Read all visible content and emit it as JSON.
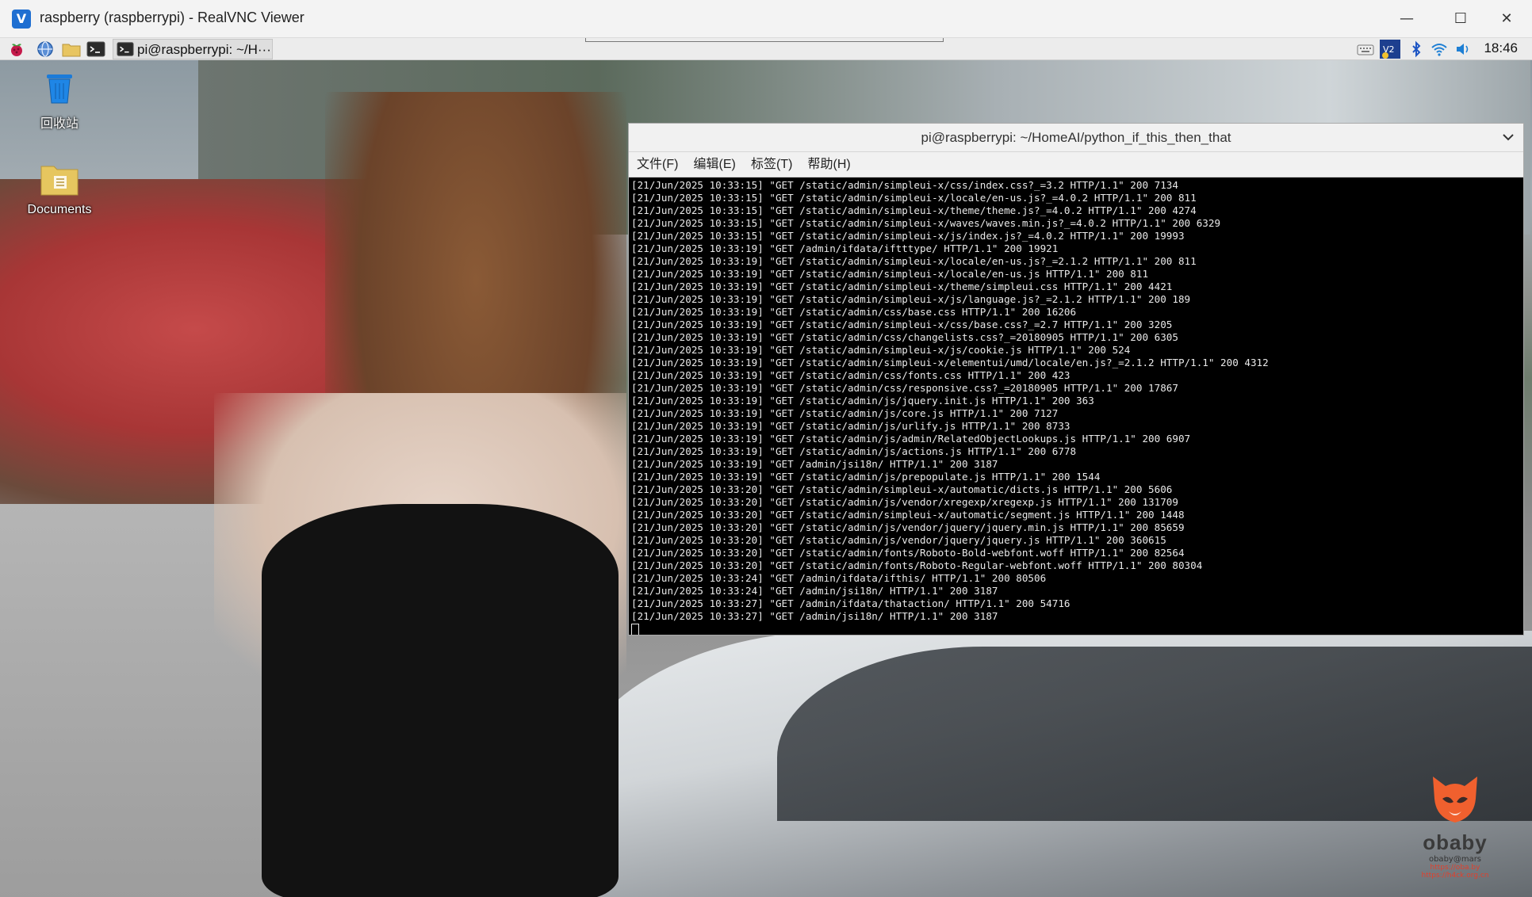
{
  "window": {
    "title": "raspberry (raspberrypi) - RealVNC Viewer",
    "controls": {
      "minimize": "—",
      "maximize": "☐",
      "close": "✕"
    }
  },
  "panel": {
    "task_label": "pi@raspberrypi: ~/H···",
    "clock": "18:46",
    "icons": [
      "raspberry-icon",
      "globe-icon",
      "folder-icon",
      "terminal-icon",
      "keyboard-icon",
      "vnc-icon",
      "bluetooth-icon",
      "wifi-icon",
      "volume-icon"
    ]
  },
  "desktop": {
    "icons": [
      {
        "label": "回收站"
      },
      {
        "label": "Documents"
      }
    ]
  },
  "terminal": {
    "title": "pi@raspberrypi: ~/HomeAI/python_if_this_then_that",
    "menu": [
      "文件(F)",
      "编辑(E)",
      "标签(T)",
      "帮助(H)"
    ],
    "lines": [
      "[21/Jun/2025 10:33:15] \"GET /static/admin/simpleui-x/css/index.css?_=3.2 HTTP/1.1\" 200 7134",
      "[21/Jun/2025 10:33:15] \"GET /static/admin/simpleui-x/locale/en-us.js?_=4.0.2 HTTP/1.1\" 200 811",
      "[21/Jun/2025 10:33:15] \"GET /static/admin/simpleui-x/theme/theme.js?_=4.0.2 HTTP/1.1\" 200 4274",
      "[21/Jun/2025 10:33:15] \"GET /static/admin/simpleui-x/waves/waves.min.js?_=4.0.2 HTTP/1.1\" 200 6329",
      "[21/Jun/2025 10:33:15] \"GET /static/admin/simpleui-x/js/index.js?_=4.0.2 HTTP/1.1\" 200 19993",
      "[21/Jun/2025 10:33:19] \"GET /admin/ifdata/iftttype/ HTTP/1.1\" 200 19921",
      "[21/Jun/2025 10:33:19] \"GET /static/admin/simpleui-x/locale/en-us.js?_=2.1.2 HTTP/1.1\" 200 811",
      "[21/Jun/2025 10:33:19] \"GET /static/admin/simpleui-x/locale/en-us.js HTTP/1.1\" 200 811",
      "[21/Jun/2025 10:33:19] \"GET /static/admin/simpleui-x/theme/simpleui.css HTTP/1.1\" 200 4421",
      "[21/Jun/2025 10:33:19] \"GET /static/admin/simpleui-x/js/language.js?_=2.1.2 HTTP/1.1\" 200 189",
      "[21/Jun/2025 10:33:19] \"GET /static/admin/css/base.css HTTP/1.1\" 200 16206",
      "[21/Jun/2025 10:33:19] \"GET /static/admin/simpleui-x/css/base.css?_=2.7 HTTP/1.1\" 200 3205",
      "[21/Jun/2025 10:33:19] \"GET /static/admin/css/changelists.css?_=20180905 HTTP/1.1\" 200 6305",
      "[21/Jun/2025 10:33:19] \"GET /static/admin/simpleui-x/js/cookie.js HTTP/1.1\" 200 524",
      "[21/Jun/2025 10:33:19] \"GET /static/admin/simpleui-x/elementui/umd/locale/en.js?_=2.1.2 HTTP/1.1\" 200 4312",
      "[21/Jun/2025 10:33:19] \"GET /static/admin/css/fonts.css HTTP/1.1\" 200 423",
      "[21/Jun/2025 10:33:19] \"GET /static/admin/css/responsive.css?_=20180905 HTTP/1.1\" 200 17867",
      "[21/Jun/2025 10:33:19] \"GET /static/admin/js/jquery.init.js HTTP/1.1\" 200 363",
      "[21/Jun/2025 10:33:19] \"GET /static/admin/js/core.js HTTP/1.1\" 200 7127",
      "[21/Jun/2025 10:33:19] \"GET /static/admin/js/urlify.js HTTP/1.1\" 200 8733",
      "[21/Jun/2025 10:33:19] \"GET /static/admin/js/admin/RelatedObjectLookups.js HTTP/1.1\" 200 6907",
      "[21/Jun/2025 10:33:19] \"GET /static/admin/js/actions.js HTTP/1.1\" 200 6778",
      "[21/Jun/2025 10:33:19] \"GET /admin/jsi18n/ HTTP/1.1\" 200 3187",
      "[21/Jun/2025 10:33:19] \"GET /static/admin/js/prepopulate.js HTTP/1.1\" 200 1544",
      "[21/Jun/2025 10:33:20] \"GET /static/admin/simpleui-x/automatic/dicts.js HTTP/1.1\" 200 5606",
      "[21/Jun/2025 10:33:20] \"GET /static/admin/js/vendor/xregexp/xregexp.js HTTP/1.1\" 200 131709",
      "[21/Jun/2025 10:33:20] \"GET /static/admin/simpleui-x/automatic/segment.js HTTP/1.1\" 200 1448",
      "[21/Jun/2025 10:33:20] \"GET /static/admin/js/vendor/jquery/jquery.min.js HTTP/1.1\" 200 85659",
      "[21/Jun/2025 10:33:20] \"GET /static/admin/js/vendor/jquery/jquery.js HTTP/1.1\" 200 360615",
      "[21/Jun/2025 10:33:20] \"GET /static/admin/fonts/Roboto-Bold-webfont.woff HTTP/1.1\" 200 82564",
      "[21/Jun/2025 10:33:20] \"GET /static/admin/fonts/Roboto-Regular-webfont.woff HTTP/1.1\" 200 80304",
      "[21/Jun/2025 10:33:24] \"GET /admin/ifdata/ifthis/ HTTP/1.1\" 200 80506",
      "[21/Jun/2025 10:33:24] \"GET /admin/jsi18n/ HTTP/1.1\" 200 3187",
      "[21/Jun/2025 10:33:27] \"GET /admin/ifdata/thataction/ HTTP/1.1\" 200 54716",
      "[21/Jun/2025 10:33:27] \"GET /admin/jsi18n/ HTTP/1.1\" 200 3187"
    ]
  },
  "watermark": {
    "name": "obaby",
    "sub": "obaby@mars",
    "url1": "https://oba.by",
    "url2": "https://h4ck.org.cn"
  },
  "colors": {
    "terminal_bg": "#000000",
    "terminal_text": "#e9e9e9",
    "titlebar_bg": "#f3f3f3",
    "accent": "#1f6fd1",
    "watermark_accent": "#e0402d"
  }
}
